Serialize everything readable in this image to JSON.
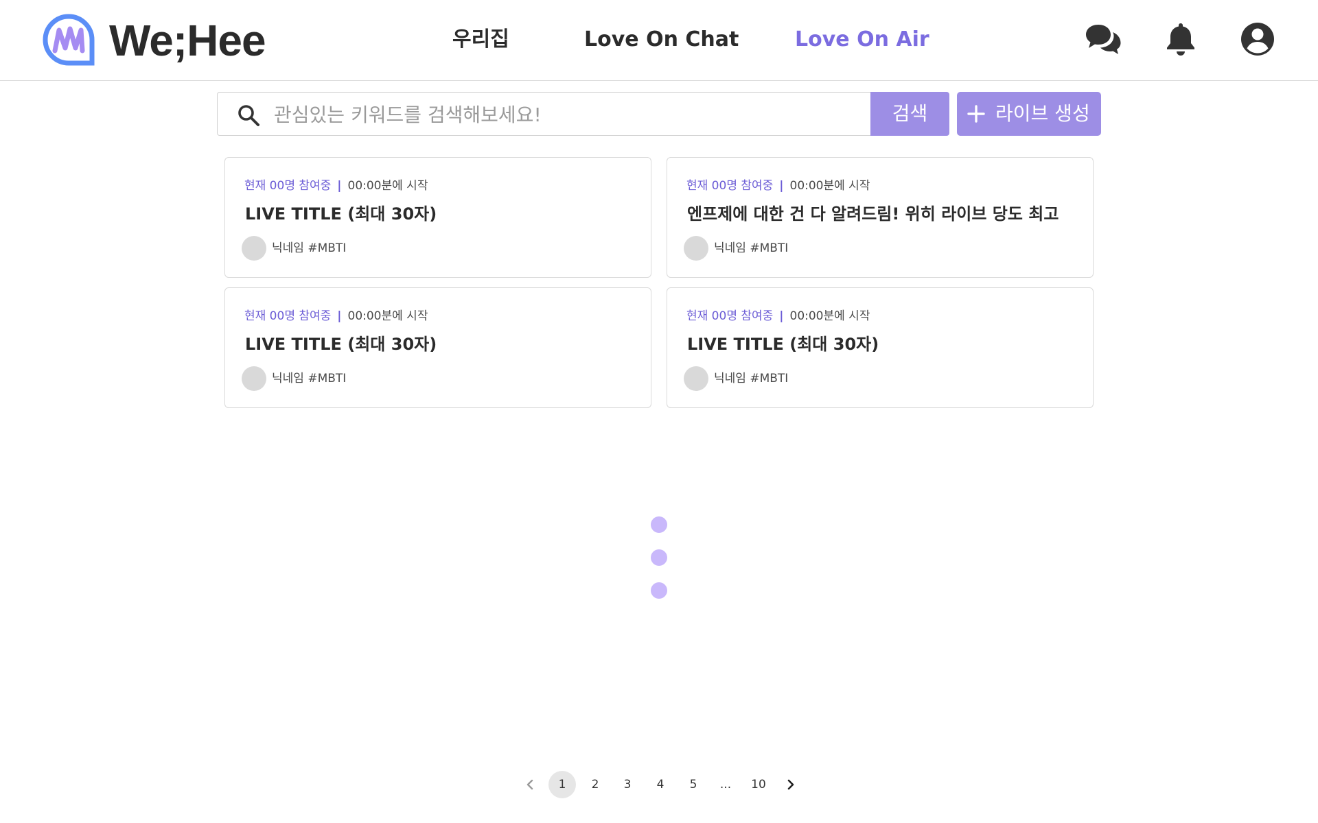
{
  "brand": {
    "name": "We;Hee",
    "mark_colors": [
      "#5b8ef7",
      "#a58cf2"
    ]
  },
  "nav": {
    "items": [
      {
        "label": "우리집",
        "active": false
      },
      {
        "label": "Love On Chat",
        "active": false
      },
      {
        "label": "Love On Air",
        "active": true
      }
    ],
    "active_color": "#7b6ce0"
  },
  "header_icons": [
    "chat-bubbles-icon",
    "bell-icon",
    "user-circle-icon"
  ],
  "search": {
    "placeholder": "관심있는 키워드를 검색해보세요!",
    "value": "",
    "button_label": "검색"
  },
  "create_button": {
    "label": "라이브 생성",
    "icon": "plus-icon"
  },
  "accent_color": "#9d8ee5",
  "live_cards": [
    {
      "participants": "현재 00명 참여중",
      "separator": "|",
      "start_time": "00:00분에 시작",
      "title": "LIVE TITLE  (최대 30자)",
      "author": "닉네임 #MBTI"
    },
    {
      "participants": "현재 00명 참여중",
      "separator": "|",
      "start_time": "00:00분에 시작",
      "title": "엔프제에 대한 건 다 알려드림! 위히 라이브 당도 최고",
      "author": "닉네임 #MBTI"
    },
    {
      "participants": "현재 00명 참여중",
      "separator": "|",
      "start_time": "00:00분에 시작",
      "title": "LIVE TITLE  (최대 30자)",
      "author": "닉네임 #MBTI"
    },
    {
      "participants": "현재 00명 참여중",
      "separator": "|",
      "start_time": "00:00분에 시작",
      "title": "LIVE TITLE  (최대 30자)",
      "author": "닉네임 #MBTI"
    }
  ],
  "loader_color": "#c9b8fb",
  "pagination": {
    "current": "1",
    "pages": [
      "1",
      "2",
      "3",
      "4",
      "5",
      "...",
      "10"
    ]
  }
}
